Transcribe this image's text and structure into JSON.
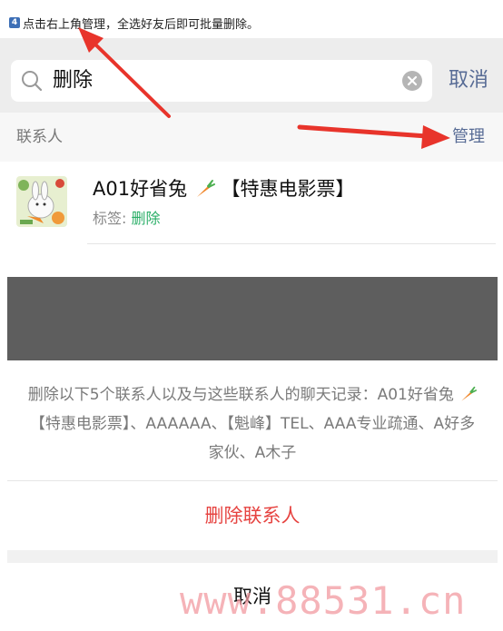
{
  "step_note": {
    "badge": "4",
    "text": "点击右上角管理，全选好友后即可批量删除。"
  },
  "search": {
    "value": "删除",
    "cancel_label": "取消"
  },
  "section": {
    "title": "联系人",
    "manage_label": "管理"
  },
  "contact": {
    "name_part1": "A01好省兔",
    "name_part2": "【特惠电影票】",
    "tag_label": "标签: ",
    "tag_value": "删除"
  },
  "action_sheet": {
    "message_part1": "删除以下5个联系人以及与这些联系人的聊天记录：A01好省兔",
    "message_part2": "【特惠电影票】、AAAAAA、【魁峰】TEL、AAA专业疏通、A好多家伙、A木子",
    "delete_label": "删除联系人",
    "cancel_label": "取消"
  },
  "watermark": "www.88531.cn",
  "colors": {
    "link_blue": "#576b95",
    "tag_green": "#2aae67",
    "danger_red": "#e64340",
    "arrow_red": "#e8342b"
  },
  "icons": [
    "search-icon",
    "clear-icon",
    "carrot-icon",
    "arrow-icon"
  ]
}
